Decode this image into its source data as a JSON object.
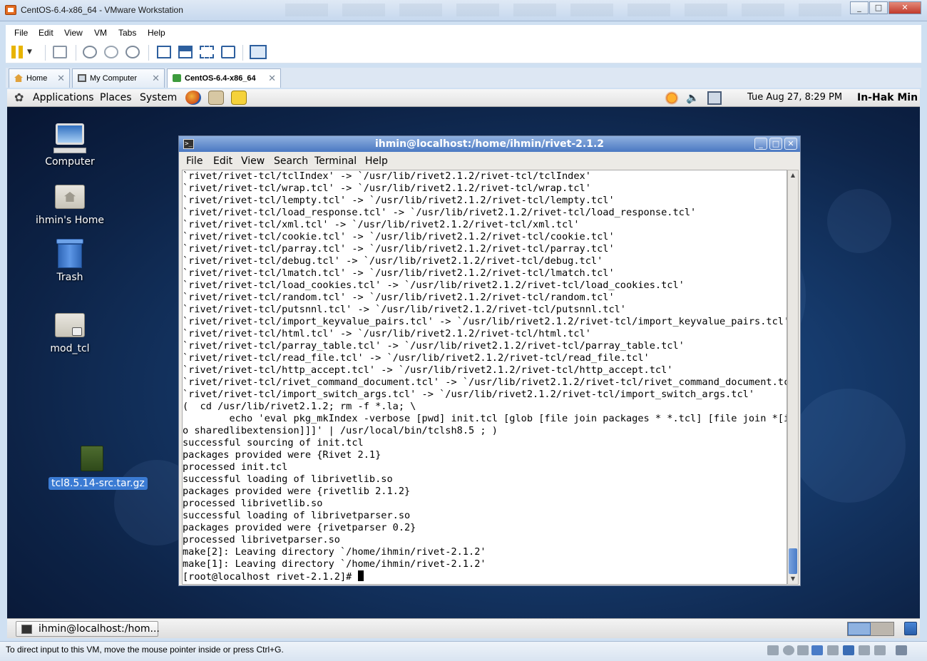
{
  "window": {
    "title": "CentOS-6.4-x86_64 - VMware Workstation"
  },
  "vm_menu": [
    "File",
    "Edit",
    "View",
    "VM",
    "Tabs",
    "Help"
  ],
  "vm_tabs": [
    {
      "label": "Home"
    },
    {
      "label": "My Computer"
    },
    {
      "label": "CentOS-6.4-x86_64"
    }
  ],
  "gnome_panel": {
    "menus": [
      "Applications",
      "Places",
      "System"
    ],
    "clock": "Tue Aug 27,  8:29 PM",
    "user": "In-Hak Min"
  },
  "desktop_icons": [
    {
      "label": "Computer"
    },
    {
      "label": "ihmin's Home"
    },
    {
      "label": "Trash"
    },
    {
      "label": "mod_tcl"
    },
    {
      "label": "tcl8.5.14-src.tar.gz"
    }
  ],
  "terminal": {
    "title": "ihmin@localhost:/home/ihmin/rivet-2.1.2",
    "menu": [
      "File",
      "Edit",
      "View",
      "Search",
      "Terminal",
      "Help"
    ],
    "lines": [
      "`rivet/rivet-tcl/tclIndex' -> `/usr/lib/rivet2.1.2/rivet-tcl/tclIndex'",
      "`rivet/rivet-tcl/wrap.tcl' -> `/usr/lib/rivet2.1.2/rivet-tcl/wrap.tcl'",
      "`rivet/rivet-tcl/lempty.tcl' -> `/usr/lib/rivet2.1.2/rivet-tcl/lempty.tcl'",
      "`rivet/rivet-tcl/load_response.tcl' -> `/usr/lib/rivet2.1.2/rivet-tcl/load_response.tcl'",
      "`rivet/rivet-tcl/xml.tcl' -> `/usr/lib/rivet2.1.2/rivet-tcl/xml.tcl'",
      "`rivet/rivet-tcl/cookie.tcl' -> `/usr/lib/rivet2.1.2/rivet-tcl/cookie.tcl'",
      "`rivet/rivet-tcl/parray.tcl' -> `/usr/lib/rivet2.1.2/rivet-tcl/parray.tcl'",
      "`rivet/rivet-tcl/debug.tcl' -> `/usr/lib/rivet2.1.2/rivet-tcl/debug.tcl'",
      "`rivet/rivet-tcl/lmatch.tcl' -> `/usr/lib/rivet2.1.2/rivet-tcl/lmatch.tcl'",
      "`rivet/rivet-tcl/load_cookies.tcl' -> `/usr/lib/rivet2.1.2/rivet-tcl/load_cookies.tcl'",
      "`rivet/rivet-tcl/random.tcl' -> `/usr/lib/rivet2.1.2/rivet-tcl/random.tcl'",
      "`rivet/rivet-tcl/putsnnl.tcl' -> `/usr/lib/rivet2.1.2/rivet-tcl/putsnnl.tcl'",
      "`rivet/rivet-tcl/import_keyvalue_pairs.tcl' -> `/usr/lib/rivet2.1.2/rivet-tcl/import_keyvalue_pairs.tcl'",
      "`rivet/rivet-tcl/html.tcl' -> `/usr/lib/rivet2.1.2/rivet-tcl/html.tcl'",
      "`rivet/rivet-tcl/parray_table.tcl' -> `/usr/lib/rivet2.1.2/rivet-tcl/parray_table.tcl'",
      "`rivet/rivet-tcl/read_file.tcl' -> `/usr/lib/rivet2.1.2/rivet-tcl/read_file.tcl'",
      "`rivet/rivet-tcl/http_accept.tcl' -> `/usr/lib/rivet2.1.2/rivet-tcl/http_accept.tcl'",
      "`rivet/rivet-tcl/rivet_command_document.tcl' -> `/usr/lib/rivet2.1.2/rivet-tcl/rivet_command_document.tcl'",
      "`rivet/rivet-tcl/import_switch_args.tcl' -> `/usr/lib/rivet2.1.2/rivet-tcl/import_switch_args.tcl'",
      "(  cd /usr/lib/rivet2.1.2; rm -f *.la; \\",
      "        echo 'eval pkg_mkIndex -verbose [pwd] init.tcl [glob [file join packages * *.tcl] [file join *[inf",
      "o sharedlibextension]]]' | /usr/local/bin/tclsh8.5 ; )",
      "successful sourcing of init.tcl",
      "packages provided were {Rivet 2.1}",
      "processed init.tcl",
      "successful loading of librivetlib.so",
      "packages provided were {rivetlib 2.1.2}",
      "processed librivetlib.so",
      "successful loading of librivetparser.so",
      "packages provided were {rivetparser 0.2}",
      "processed librivetparser.so",
      "make[2]: Leaving directory `/home/ihmin/rivet-2.1.2'",
      "make[1]: Leaving directory `/home/ihmin/rivet-2.1.2'"
    ],
    "prompt": "[root@localhost rivet-2.1.2]# "
  },
  "taskbar": {
    "task_label": "ihmin@localhost:/hom..."
  },
  "status_bar": {
    "text": "To direct input to this VM, move the mouse pointer inside or press Ctrl+G."
  },
  "colors": {
    "accent": "#3b7bd3",
    "terminal_title": "#4a78c2",
    "desktop": "#163b6d"
  }
}
